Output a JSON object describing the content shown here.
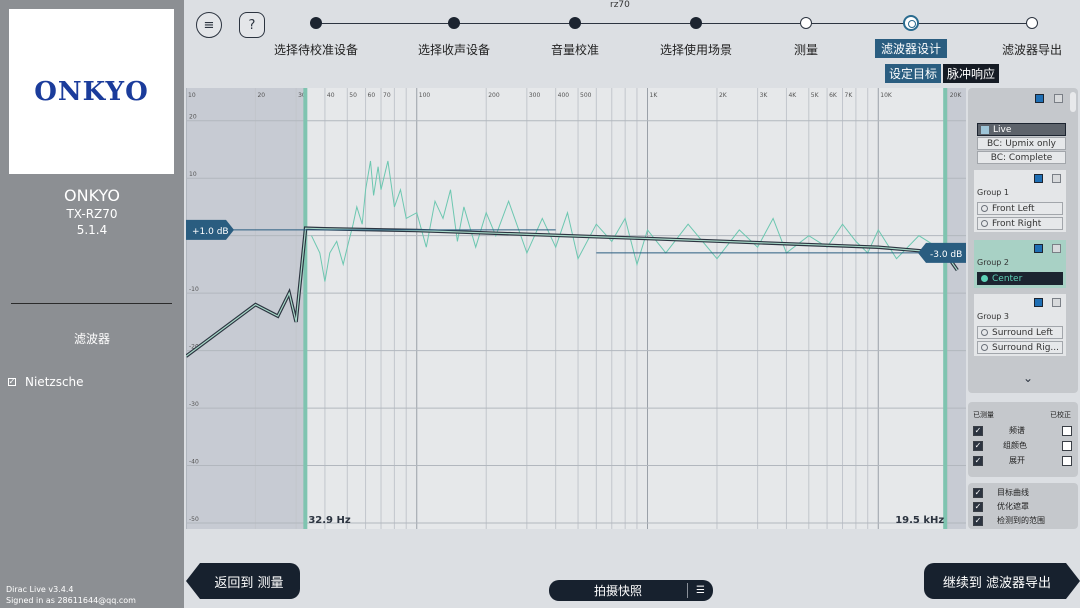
{
  "window": {
    "title": "rz70"
  },
  "sidebar": {
    "logo_text": "ONKYO",
    "device_brand": "ONKYO",
    "device_model": "TX-RZ70",
    "device_config": "5.1.4",
    "filters_title": "滤波器",
    "filters": [
      {
        "label": "Nietzsche",
        "checked": true
      }
    ],
    "app_version": "Dirac Live v3.4.4",
    "signed_in": "Signed in as 28611644@qq.com"
  },
  "top": {
    "menu_icon": "menu-icon",
    "help_icon": "?",
    "steps": [
      {
        "label": "选择待校准设备",
        "state": "done"
      },
      {
        "label": "选择收声设备",
        "state": "done"
      },
      {
        "label": "音量校准",
        "state": "done"
      },
      {
        "label": "选择使用场景",
        "state": "done"
      },
      {
        "label": "测量",
        "state": "todo"
      },
      {
        "label": "滤波器设计",
        "state": "active"
      },
      {
        "label": "滤波器导出",
        "state": "todo"
      }
    ],
    "sub_tabs": [
      "设定目标",
      "脉冲响应"
    ]
  },
  "chart_data": {
    "type": "line",
    "x_scale": "log",
    "xlim": [
      10,
      24000
    ],
    "ylim": [
      -50,
      25
    ],
    "x_ticks": [
      "10",
      "20",
      "30",
      "40",
      "50",
      "60",
      "70",
      "100",
      "200",
      "300",
      "400",
      "500",
      "1K",
      "2K",
      "3K",
      "4K",
      "5K",
      "6K",
      "7K",
      "10K",
      "20K"
    ],
    "y_ticks": [
      "20",
      "10",
      "0",
      "-10",
      "-20",
      "-30",
      "-40",
      "-50"
    ],
    "left_cutoff_label": "32.9 Hz",
    "right_cutoff_label": "19.5 kHz",
    "left_cutoff_hz": 32.9,
    "right_cutoff_hz": 19500,
    "target_left_label": "+1.0 dB",
    "target_right_label": "-3.0 dB",
    "target_curve": {
      "x": [
        10,
        20,
        25,
        28,
        30,
        33,
        40,
        100,
        1000,
        10000,
        19500,
        22000
      ],
      "y": [
        -21,
        -12,
        -14,
        -10,
        -15,
        1.3,
        1.2,
        0.9,
        -0.5,
        -2.0,
        -3.0,
        -6
      ]
    },
    "series": [
      {
        "x": [
          35,
          38,
          40,
          42,
          45,
          48,
          50,
          53,
          55,
          58,
          60,
          63,
          65,
          68,
          70,
          75,
          80,
          85,
          90,
          100,
          110,
          120,
          130,
          140,
          150,
          160,
          180,
          200,
          220,
          250,
          300,
          350,
          400,
          450,
          500,
          600,
          700,
          800,
          900,
          1000,
          1200,
          1500,
          2000,
          2500,
          3000,
          3500,
          4000,
          5000,
          6000,
          7000,
          8000,
          9000,
          10000,
          12000,
          15000,
          18000,
          19500
        ],
        "y": [
          0,
          -3,
          -8,
          -3,
          -1,
          -5,
          -2,
          2,
          5,
          2,
          8,
          13,
          7,
          12,
          8,
          13,
          5,
          8,
          3,
          4,
          -2,
          6,
          3,
          8,
          -1,
          5,
          -2,
          4,
          0,
          6,
          -3,
          3,
          -2,
          4,
          -4,
          2,
          -1,
          3,
          -5,
          1,
          -3,
          2,
          -4,
          1,
          -2,
          3,
          -3,
          0,
          -2,
          2,
          -1,
          -3,
          1,
          -4,
          0,
          -2,
          -3
        ]
      }
    ]
  },
  "right_panel": {
    "scenarios": [
      "Live",
      "BC: Upmix only",
      "BC: Complete"
    ],
    "groups": [
      {
        "title": "Group 1",
        "channels": [
          {
            "name": "Front Left",
            "active": false
          },
          {
            "name": "Front Right",
            "active": false
          }
        ]
      },
      {
        "title": "Group 2",
        "channels": [
          {
            "name": "Center",
            "active": true
          }
        ]
      },
      {
        "title": "Group 3",
        "channels": [
          {
            "name": "Surround Left",
            "active": false
          },
          {
            "name": "Surround Rig...",
            "active": false
          }
        ]
      }
    ]
  },
  "measured_panel": {
    "left_header": "已测量",
    "right_header": "已校正",
    "rows": [
      "频谱",
      "组颜色",
      "展开"
    ]
  },
  "options_panel": {
    "rows": [
      "目标曲线",
      "优化遮罩",
      "检测到的范围"
    ]
  },
  "bottom": {
    "back_label": "返回到 测量",
    "snapshot_label": "拍摄快照",
    "next_label": "继续到 滤波器导出"
  }
}
